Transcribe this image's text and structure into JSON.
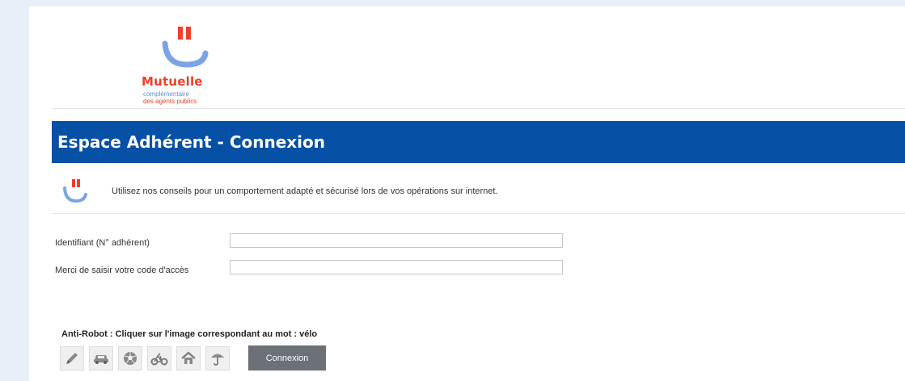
{
  "logo": {
    "name": "Mutuelle",
    "tagline_line1": "complémentaire",
    "tagline_line2": "des agents publics",
    "icon": "smile-logo-icon",
    "colors": {
      "red": "#e8412c",
      "blue": "#5a8fd8"
    }
  },
  "banner": {
    "title": "Espace Adhérent - Connexion",
    "color": "#0650a5"
  },
  "info": {
    "icon": "smile-logo-icon",
    "text": "Utilisez nos conseils pour un comportement adapté et sécurisé lors de vos opérations sur internet."
  },
  "form": {
    "identifiant_label": "Identifiant (N° adhérent)",
    "identifiant_value": "",
    "code_label": "Merci de saisir votre code d'accès",
    "code_value": ""
  },
  "antirobot": {
    "label": "Anti-Robot : Cliquer sur l'image correspondant au mot : vélo",
    "options": [
      "pencil-icon",
      "car-icon",
      "ball-icon",
      "bicycle-icon",
      "house-icon",
      "umbrella-icon"
    ]
  },
  "submit_label": "Connexion"
}
